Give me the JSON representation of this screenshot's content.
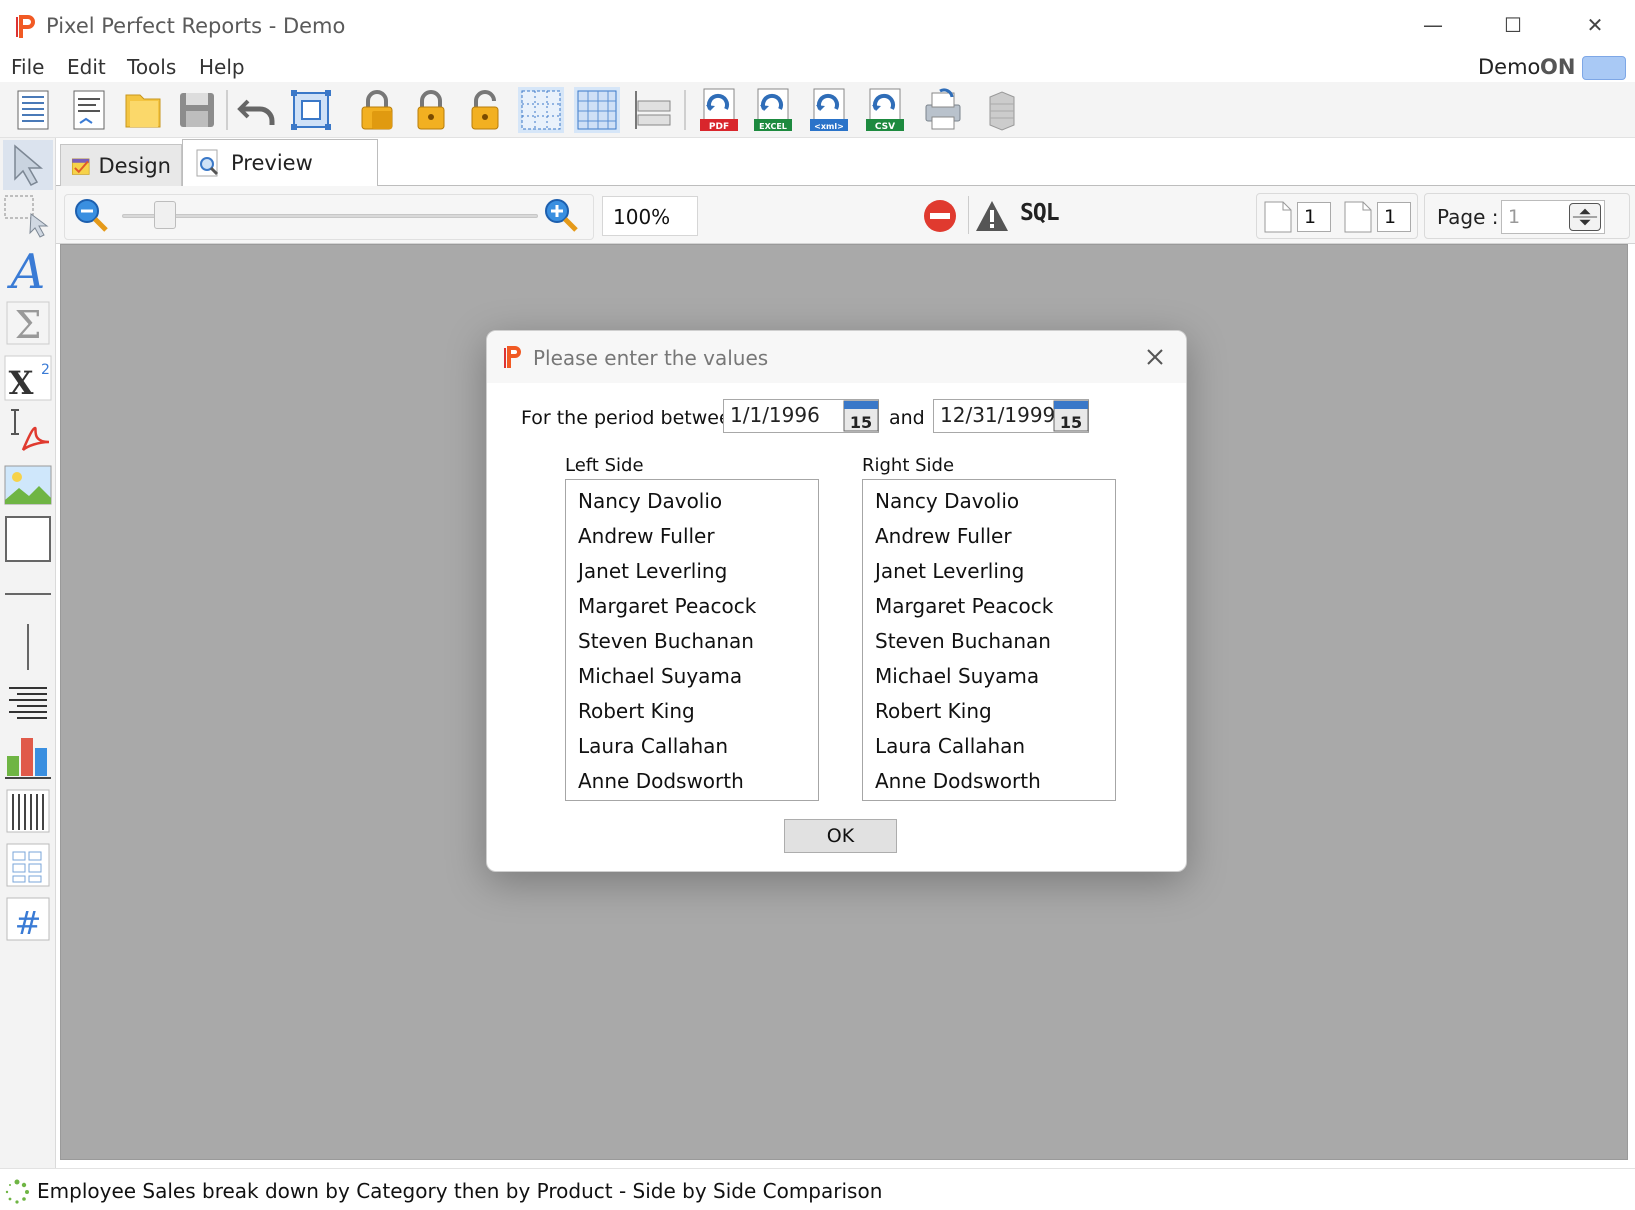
{
  "window": {
    "title": "Pixel Perfect Reports - Demo",
    "controls": {
      "minimize": "—",
      "maximize": "☐",
      "close": "✕"
    }
  },
  "menu": {
    "items": [
      "File",
      "Edit",
      "Tools",
      "Help"
    ],
    "demo_label": "Demo",
    "demo_state": "ON"
  },
  "toolbar": {
    "buttons": [
      "new-report-icon",
      "report-properties-icon",
      "open-folder-icon",
      "save-icon",
      "undo-icon",
      "select-all-icon",
      "lock-all-icon",
      "lock-icon",
      "unlock-icon",
      "grid-dots-icon",
      "grid-lines-icon",
      "align-icon",
      "export-pdf-icon",
      "export-excel-icon",
      "export-xml-icon",
      "export-csv-icon",
      "print-icon",
      "database-icon"
    ],
    "export_badges": {
      "pdf": "PDF",
      "excel": "EXCEL",
      "xml": "<xml>",
      "csv": "CSV"
    }
  },
  "tabs": [
    {
      "label": "Design",
      "active": false
    },
    {
      "label": "Preview",
      "active": true
    }
  ],
  "preview_toolbar": {
    "zoom": "100%",
    "zoom_fraction": 0.1,
    "sql_label": "SQL",
    "page_count_a": "1",
    "page_count_b": "1",
    "page_label": "Page :",
    "page_value": "1"
  },
  "dialog": {
    "title": "Please enter the values",
    "period_label": "For the period between",
    "start_date": "1/1/1996",
    "and_label": "and",
    "end_date": "12/31/1999",
    "calendar_day": "15",
    "left_side_label": "Left Side",
    "right_side_label": "Right Side",
    "left_items": [
      "Nancy Davolio",
      "Andrew Fuller",
      "Janet Leverling",
      "Margaret Peacock",
      "Steven Buchanan",
      "Michael Suyama",
      "Robert King",
      "Laura Callahan",
      "Anne Dodsworth"
    ],
    "right_items": [
      "Nancy Davolio",
      "Andrew Fuller",
      "Janet Leverling",
      "Margaret Peacock",
      "Steven Buchanan",
      "Michael Suyama",
      "Robert King",
      "Laura Callahan",
      "Anne Dodsworth"
    ],
    "ok_label": "OK"
  },
  "status": {
    "text": "Employee Sales break down by Category then by Product - Side by Side Comparison"
  },
  "colors": {
    "canvas": "#a9a9a9",
    "accent_toggle": "#a9c9f5",
    "stop_red": "#e03a2f",
    "logo_orange": "#f15a24"
  }
}
